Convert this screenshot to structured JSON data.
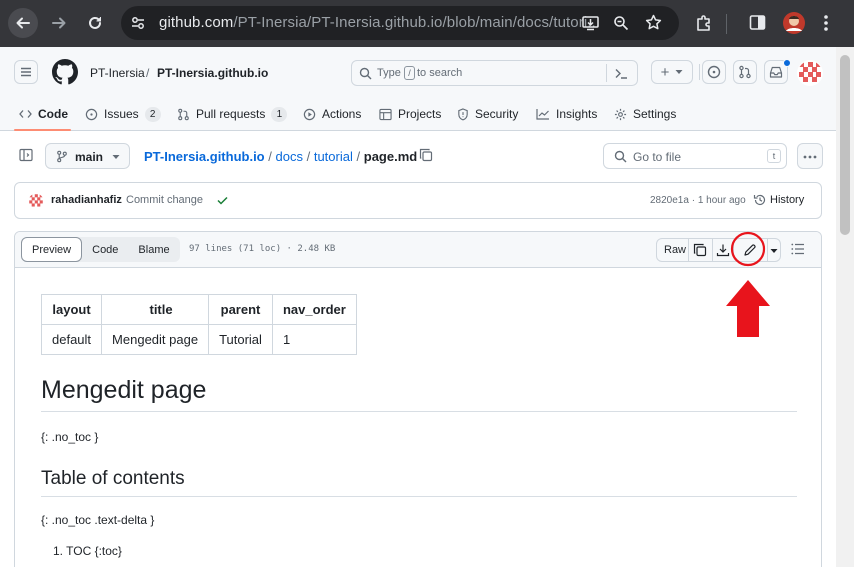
{
  "browser": {
    "url_host": "github.com",
    "url_path": "/PT-Inersia/PT-Inersia.github.io/blob/main/docs/tutori..."
  },
  "header": {
    "owner": "PT-Inersia",
    "separator": "/",
    "repo": "PT-Inersia.github.io",
    "search_placeholder_type": "Type",
    "search_key": "/",
    "search_placeholder_rest": "to search",
    "plus_label": "+"
  },
  "tabs": [
    {
      "label": "Code"
    },
    {
      "label": "Issues",
      "count": "2"
    },
    {
      "label": "Pull requests",
      "count": "1"
    },
    {
      "label": "Actions"
    },
    {
      "label": "Projects"
    },
    {
      "label": "Security"
    },
    {
      "label": "Insights"
    },
    {
      "label": "Settings"
    }
  ],
  "file_nav": {
    "branch": "main",
    "path_repo": "PT-Inersia.github.io",
    "path_docs": "docs",
    "path_tutorial": "tutorial",
    "path_file": "page.md",
    "sep": "/",
    "go_to_file": "Go to file",
    "go_key": "t"
  },
  "commit": {
    "author": "rahadianhafiz",
    "message": "Commit change",
    "hash_time": "2820e1a · 1 hour ago",
    "history": "History"
  },
  "file_toolbar": {
    "preview": "Preview",
    "code": "Code",
    "blame": "Blame",
    "meta": "97 lines (71 loc) · 2.48 KB",
    "raw": "Raw"
  },
  "front_matter": {
    "headers": [
      "layout",
      "title",
      "parent",
      "nav_order"
    ],
    "values": [
      "default",
      "Mengedit page",
      "Tutorial",
      "1"
    ]
  },
  "content": {
    "h1": "Mengedit page",
    "p1": "{: .no_toc }",
    "h2": "Table of contents",
    "p2": "{: .no_toc .text-delta }",
    "li1": "TOC {:toc}"
  },
  "colors": {
    "annotation": "#e8141c",
    "link": "#0969da",
    "tab_underline": "#fd8c73"
  },
  "icons": [
    "back-arrow-icon",
    "forward-arrow-icon",
    "reload-icon",
    "site-info-icon",
    "install-app-icon",
    "zoom-icon",
    "star-icon",
    "extensions-icon",
    "side-panel-icon",
    "profile-avatar-icon",
    "kebab-menu-icon",
    "hamburger-icon",
    "github-logo-icon",
    "command-palette-icon",
    "issues-circle-icon",
    "pull-request-icon",
    "inbox-icon",
    "pencil-icon",
    "download-icon",
    "copy-icon",
    "history-icon",
    "check-icon",
    "outline-list-icon",
    "sidebar-expand-icon",
    "branch-icon",
    "annotation-arrow-icon"
  ]
}
